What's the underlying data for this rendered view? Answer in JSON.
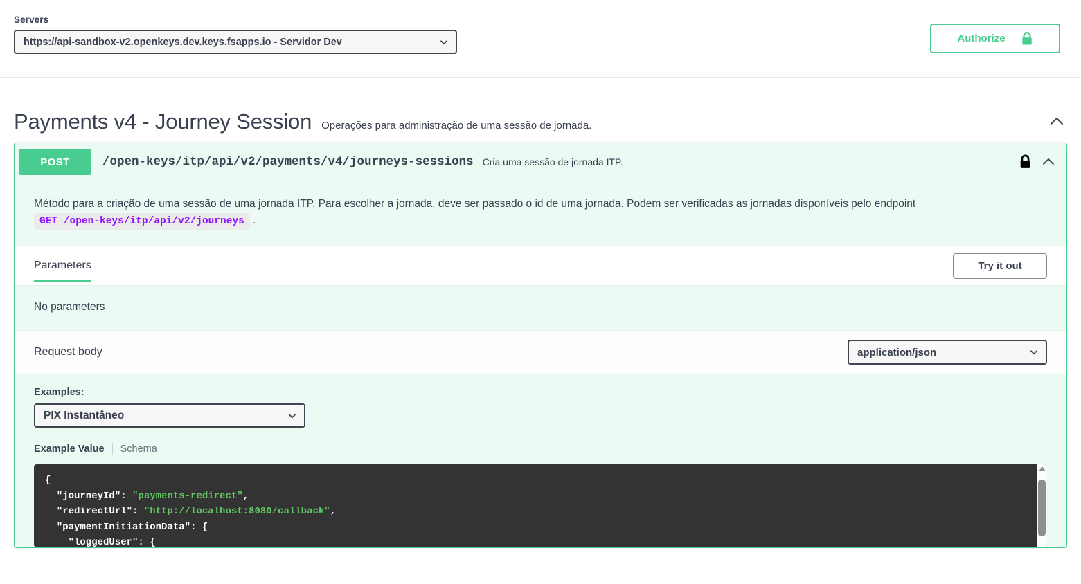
{
  "servers": {
    "label": "Servers",
    "selected": "https://api-sandbox-v2.openkeys.dev.keys.fsapps.io - Servidor Dev",
    "options": [
      "https://api-sandbox-v2.openkeys.dev.keys.fsapps.io - Servidor Dev"
    ]
  },
  "authorize": {
    "label": "Authorize",
    "icon": "lock-icon",
    "accent_color": "#49cc90"
  },
  "tag": {
    "title": "Payments v4 - Journey Session",
    "description": "Operações para administração de uma sessão de jornada.",
    "collapse_icon": "chevron-up-icon"
  },
  "operation": {
    "method": "POST",
    "method_color": "#49cc90",
    "path": "/open-keys/itp/api/v2/payments/v4/journeys-sessions",
    "summary": "Cria uma sessão de jornada ITP.",
    "auth_icon": "lock-icon",
    "collapse_icon": "chevron-up-icon",
    "description_part1": "Método para a criação de uma sessão de uma jornada ITP. Para escolher a jornada, deve ser passado o id de uma jornada. Podem ser verificadas as jornadas disponíveis pelo endpoint",
    "description_code": "GET /open-keys/itp/api/v2/journeys",
    "description_part2": ".",
    "tabs": {
      "parameters": "Parameters"
    },
    "try_it_out": "Try it out",
    "no_parameters": "No parameters",
    "request_body_label": "Request body",
    "content_type": {
      "selected": "application/json",
      "options": [
        "application/json"
      ]
    },
    "examples": {
      "label": "Examples:",
      "selected": "PIX Instantâneo",
      "options": [
        "PIX Instantâneo"
      ]
    },
    "example_tabs": {
      "example_value": "Example Value",
      "schema": "Schema"
    },
    "example_code_lines": [
      {
        "text": "{",
        "indent": 0
      },
      {
        "key": "\"journeyId\"",
        "value": "\"payments-redirect\"",
        "trail": ",",
        "indent": 1
      },
      {
        "key": "\"redirectUrl\"",
        "value": "\"http://localhost:8080/callback\"",
        "trail": ",",
        "indent": 1
      },
      {
        "key": "\"paymentInitiationData\"",
        "value": "{",
        "trail": "",
        "indent": 1
      },
      {
        "key": "\"loggedUser\"",
        "value": "{",
        "trail": "",
        "indent": 2
      }
    ]
  }
}
